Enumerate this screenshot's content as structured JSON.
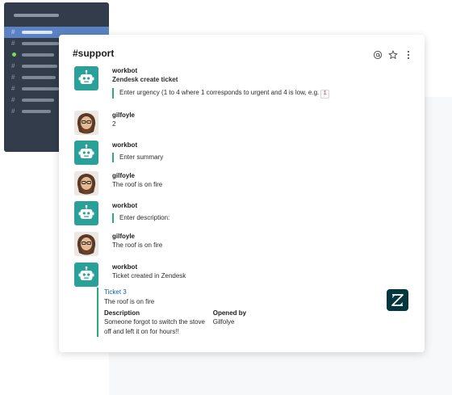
{
  "channel": {
    "title": "#support"
  },
  "header_icons": [
    "at-icon",
    "star-icon",
    "more-vertical-icon"
  ],
  "sidebar": {
    "rows": [
      "#",
      "#",
      "",
      "#",
      "#",
      "#",
      "#",
      "#"
    ]
  },
  "messages": [
    {
      "author": "workbot",
      "lines": [
        "Zendesk create ticket"
      ],
      "quote": "Enter urgency (1 to 4 where 1 corresponds to urgent and 4 is low, e.g. ",
      "quote_code": "1"
    },
    {
      "author": "gilfoyle",
      "lines": [
        "2"
      ]
    },
    {
      "author": "workbot",
      "quote": "Enter summary"
    },
    {
      "author": "gilfoyle",
      "lines": [
        "The roof is on fire"
      ]
    },
    {
      "author": "workbot",
      "quote": "Enter description:"
    },
    {
      "author": "gilfoyle",
      "lines": [
        "The roof is on fire"
      ]
    },
    {
      "author": "workbot",
      "lines": [
        "Ticket created in Zendesk"
      ]
    }
  ],
  "ticket": {
    "link": "Ticket 3",
    "summary": "The roof is on fire",
    "description_label": "Description",
    "description_value": "Someone forgot to switch the stove off and left it on for hours!!",
    "opened_by_label": "Opened by",
    "opened_by_value": "Gilfolye"
  },
  "colors": {
    "accent_green": "#2bac76",
    "link_blue": "#1264a3",
    "bot_teal": "#2aa198",
    "zendesk": "#03363d",
    "sidebar": "#323c4b",
    "sidebar_active": "#5b82c2"
  }
}
